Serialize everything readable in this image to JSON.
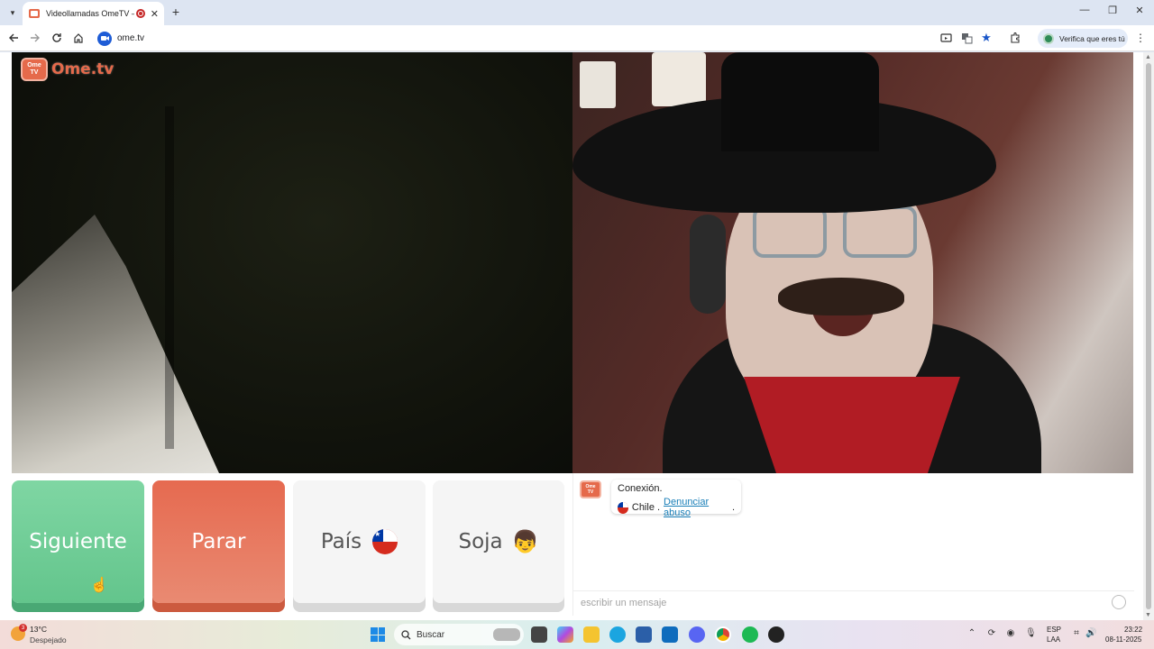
{
  "browser": {
    "tab_title": "Videollamadas OmeTV — A",
    "url": "ome.tv",
    "verify_label": "Verifica que eres tú"
  },
  "page": {
    "logo_badge_line1": "Ome",
    "logo_badge_line2": "TV",
    "logo_text": "Ome.tv",
    "buttons": {
      "next": "Siguiente",
      "stop": "Parar",
      "country": "País",
      "gender": "Soja"
    },
    "chat": {
      "connection": "Conexión.",
      "country": "Chile",
      "separator": ".",
      "report_link": "Denunciar abuso",
      "report_suffix": ".",
      "input_placeholder": "escribir un mensaje"
    }
  },
  "taskbar": {
    "weather_badge": "3",
    "temperature": "13°C",
    "weather_desc": "Despejado",
    "search_label": "Buscar",
    "language_line1": "ESP",
    "language_line2": "LAA",
    "time": "23:22",
    "date": "08-11-2025"
  },
  "colors": {
    "next": "#63c58c",
    "stop": "#e66a50",
    "brand": "#e56a4b",
    "link": "#1a7fb8"
  }
}
